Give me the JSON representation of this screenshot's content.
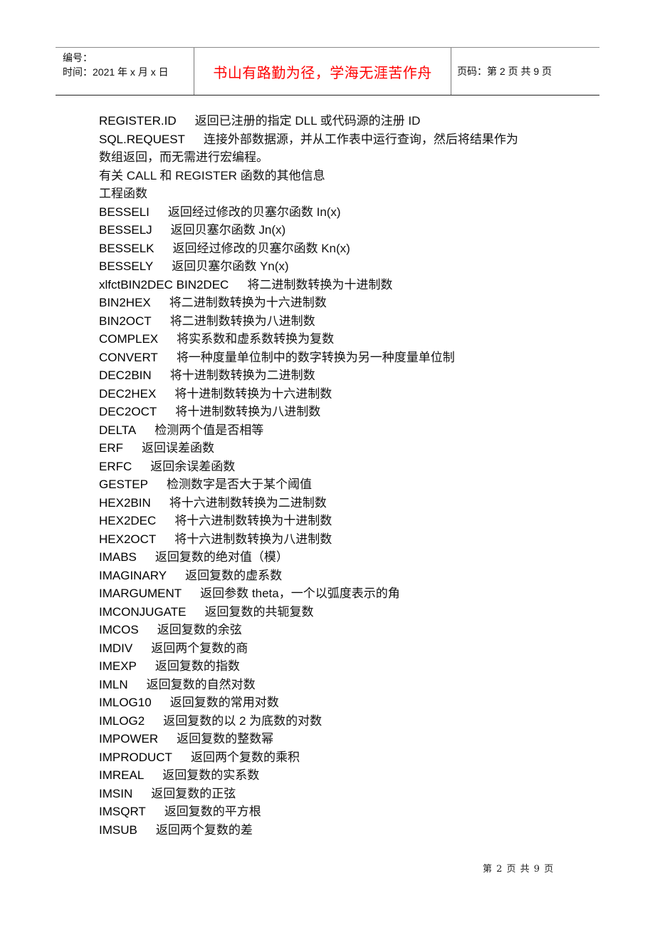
{
  "header": {
    "serial_label": "编号：",
    "date_label": "时间：2021 年 x 月 x 日",
    "motto": "书山有路勤为径，学海无涯苦作舟",
    "page_info": "页码：第 2 页  共 9 页"
  },
  "content": {
    "lines": [
      {
        "name": "REGISTER.ID",
        "desc": "返回已注册的指定 DLL 或代码源的注册 ID"
      },
      {
        "name": "SQL.REQUEST",
        "desc": "连接外部数据源，并从工作表中运行查询，然后将结果作为"
      },
      {
        "name": "",
        "desc": "数组返回，而无需进行宏编程。"
      },
      {
        "name": "",
        "desc": "有关 CALL 和 REGISTER 函数的其他信息"
      },
      {
        "name": "",
        "desc": "工程函数"
      },
      {
        "name": "BESSELI",
        "desc": "返回经过修改的贝塞尔函数 In(x)"
      },
      {
        "name": "BESSELJ",
        "desc": "返回贝塞尔函数 Jn(x)"
      },
      {
        "name": "BESSELK",
        "desc": "返回经过修改的贝塞尔函数 Kn(x)"
      },
      {
        "name": "BESSELY",
        "desc": "返回贝塞尔函数 Yn(x)"
      },
      {
        "name": "xlfctBIN2DEC BIN2DEC",
        "desc": "将二进制数转换为十进制数"
      },
      {
        "name": "BIN2HEX",
        "desc": "将二进制数转换为十六进制数"
      },
      {
        "name": "BIN2OCT",
        "desc": "将二进制数转换为八进制数"
      },
      {
        "name": "COMPLEX",
        "desc": "将实系数和虚系数转换为复数"
      },
      {
        "name": "CONVERT",
        "desc": "将一种度量单位制中的数字转换为另一种度量单位制"
      },
      {
        "name": "DEC2BIN",
        "desc": "将十进制数转换为二进制数"
      },
      {
        "name": "DEC2HEX",
        "desc": "将十进制数转换为十六进制数"
      },
      {
        "name": "DEC2OCT",
        "desc": "将十进制数转换为八进制数"
      },
      {
        "name": "DELTA",
        "desc": "检测两个值是否相等"
      },
      {
        "name": "ERF",
        "desc": "返回误差函数"
      },
      {
        "name": "ERFC",
        "desc": "返回余误差函数"
      },
      {
        "name": "GESTEP",
        "desc": "检测数字是否大于某个阈值"
      },
      {
        "name": "HEX2BIN",
        "desc": "将十六进制数转换为二进制数"
      },
      {
        "name": "HEX2DEC",
        "desc": "将十六进制数转换为十进制数"
      },
      {
        "name": "HEX2OCT",
        "desc": "将十六进制数转换为八进制数"
      },
      {
        "name": "IMABS",
        "desc": "返回复数的绝对值（模）"
      },
      {
        "name": "IMAGINARY",
        "desc": "返回复数的虚系数"
      },
      {
        "name": "IMARGUMENT",
        "desc": "返回参数 theta，一个以弧度表示的角"
      },
      {
        "name": "IMCONJUGATE",
        "desc": "返回复数的共轭复数"
      },
      {
        "name": "IMCOS",
        "desc": "返回复数的余弦"
      },
      {
        "name": "IMDIV",
        "desc": "返回两个复数的商"
      },
      {
        "name": "IMEXP",
        "desc": "返回复数的指数"
      },
      {
        "name": "IMLN",
        "desc": "返回复数的自然对数"
      },
      {
        "name": "IMLOG10",
        "desc": "返回复数的常用对数"
      },
      {
        "name": "IMLOG2",
        "desc": "返回复数的以 2 为底数的对数"
      },
      {
        "name": "IMPOWER",
        "desc": "返回复数的整数幂"
      },
      {
        "name": "IMPRODUCT",
        "desc": "返回两个复数的乘积"
      },
      {
        "name": "IMREAL",
        "desc": "返回复数的实系数"
      },
      {
        "name": "IMSIN",
        "desc": "返回复数的正弦"
      },
      {
        "name": "IMSQRT",
        "desc": "返回复数的平方根"
      },
      {
        "name": "IMSUB",
        "desc": "返回两个复数的差"
      }
    ]
  },
  "footer": {
    "page_info": "第 2 页 共 9 页"
  },
  "colors": {
    "motto": "#ff0000",
    "text": "#000000"
  }
}
